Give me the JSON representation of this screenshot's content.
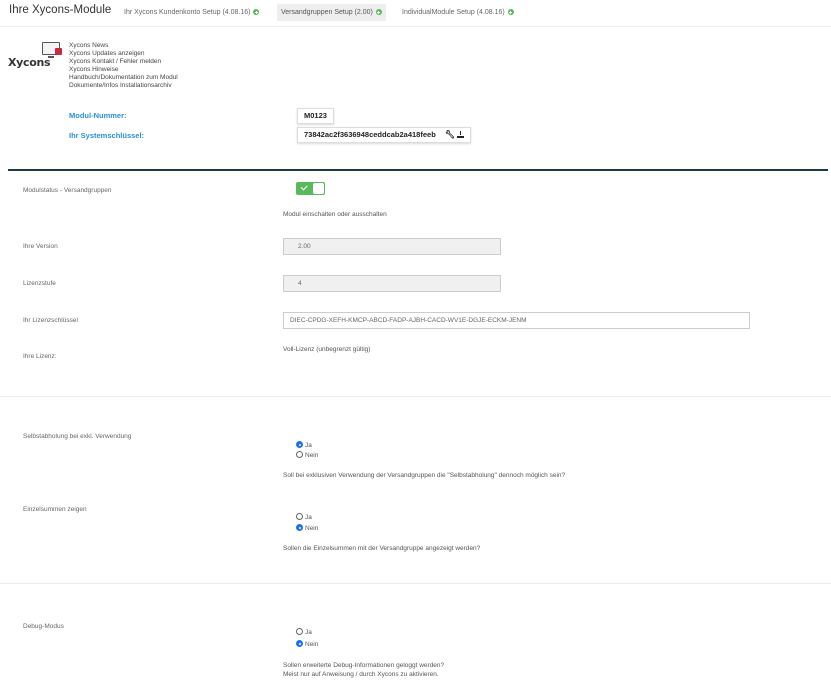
{
  "header": {
    "title": "Ihre Xycons-Module",
    "tabs": [
      {
        "label": "Ihr Xycons Kundenkonto Setup (4.08.16)"
      },
      {
        "label": "Versandgruppen Setup (2.00)"
      },
      {
        "label": "IndividualModule Setup (4.08.16)"
      }
    ]
  },
  "info": {
    "logo_text": "Xycons",
    "links": [
      "Xycons News",
      "Xycons Updates anzeigen",
      "Xycons Kontakt / Fehler melden",
      "Xycons Hinweise",
      "Handbuch/Dokumentation zum Modul",
      "Dokumente/Infos Installationsarchiv"
    ],
    "modul_nummer_label": "Modul-Nummer:",
    "modul_nummer": "M0123",
    "system_key_label": "Ihr Systemschlüssel:",
    "system_key": "73842ac2f3636948ceddcab2a418feeb"
  },
  "settings": {
    "status_label": "Modulstatus - Versandgruppen",
    "status_enabled": true,
    "status_help": "Modul einschalten oder ausschalten",
    "version_label": "Ihre Version",
    "version_value": "2.00",
    "lizenzstufe_label": "Lizenzstufe",
    "lizenzstufe_value": "4",
    "lizenzkey_label": "Ihr Lizenzschlüssel",
    "lizenzkey_value": "DIEC-CPDG-XEFH-KMCP-ABCD-FADP-AJBH-CACD-WV1E-DGJE-ECKM-JENM",
    "lizenz_label": "Ihre Lizenz:",
    "lizenz_value": "Voll-Lizenz (unbegrenzt gültig)"
  },
  "options": {
    "ja": "Ja",
    "nein": "Nein",
    "selbst_label": "Selbstabholung bei exkl. Verwendung",
    "selbst_selected": "Ja",
    "selbst_help": "Soll bei exklusiven Verwendung der Versandgruppen die \"Selbstabholung\" dennoch möglich sein?",
    "einzel_label": "Einzelsummen zeigen",
    "einzel_selected": "Nein",
    "einzel_help": "Sollen die Einzelsummen mit der Versandgruppe angezeigt werden?",
    "debug_label": "Debug-Modus",
    "debug_selected": "Nein",
    "debug_help_1": "Sollen erweiterte Debug-Informationen geloggt werden?",
    "debug_help_2": "Meist nur auf Anweisung / durch Xycons zu aktivieren."
  },
  "colors": {
    "accent_blue": "#2a8fd6",
    "success_green": "#5cb85c",
    "divider_dark": "#1e3a44",
    "logo_red": "#c9283e"
  }
}
